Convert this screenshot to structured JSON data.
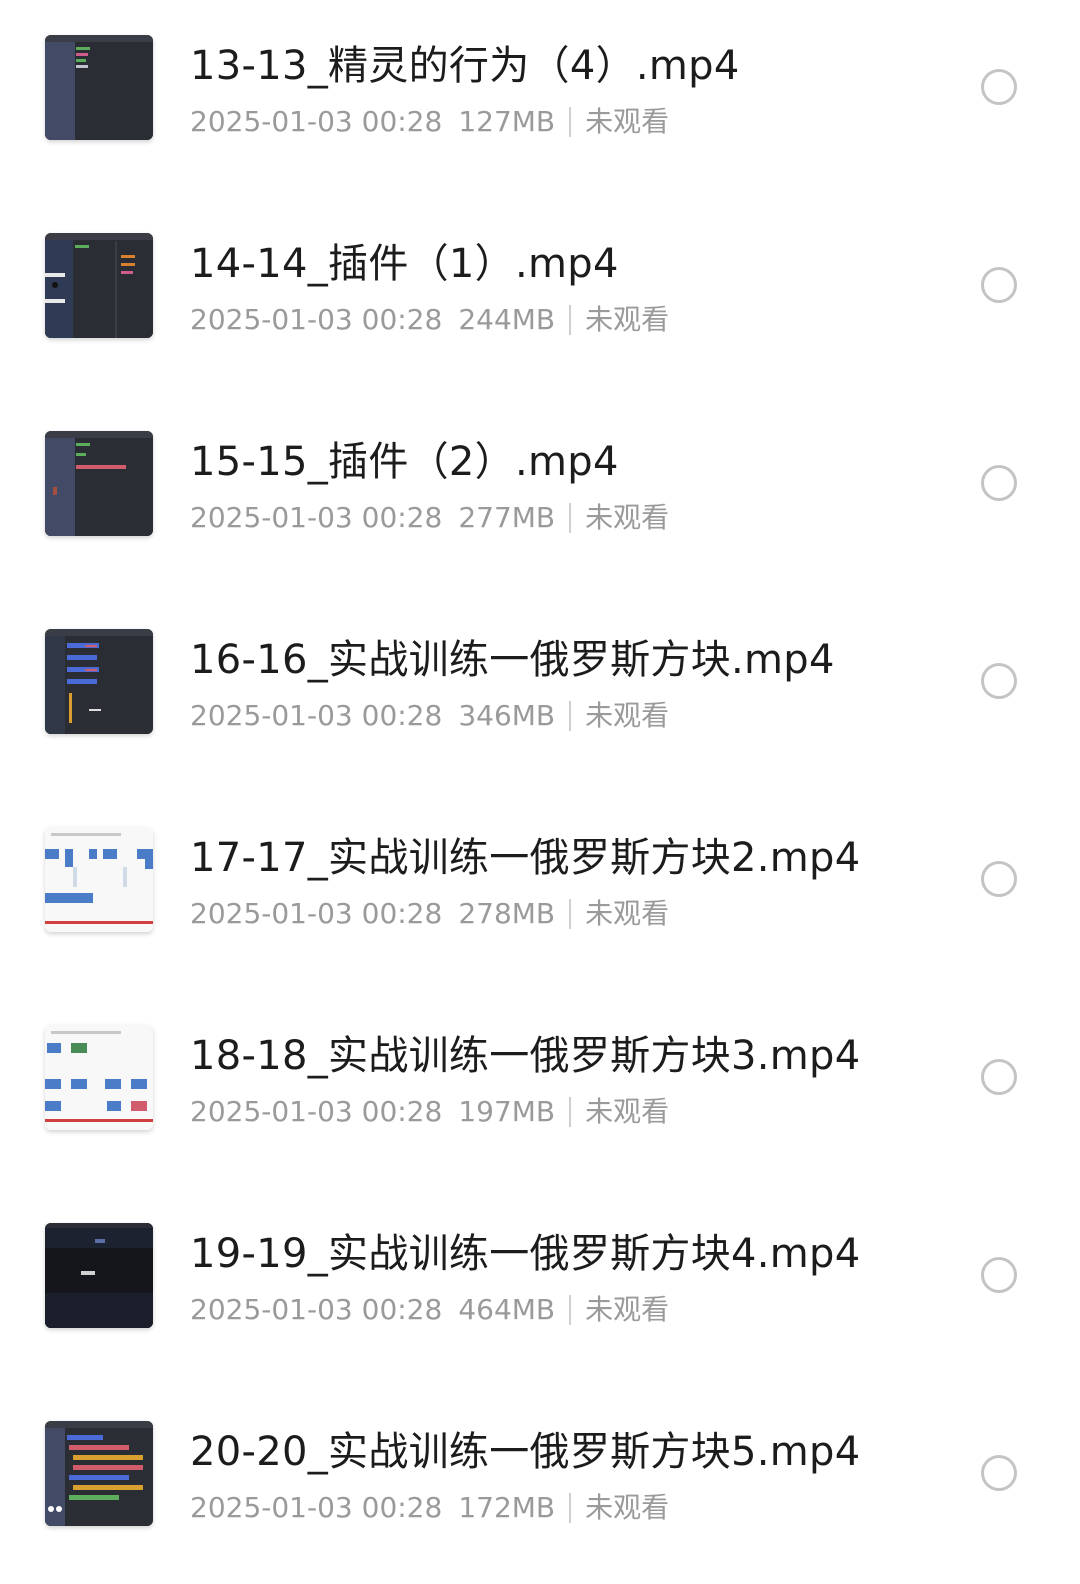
{
  "files": [
    {
      "title": "13-13_精灵的行为（4）.mp4",
      "date": "2025-01-03 00:28",
      "size": "127MB",
      "status": "未观看",
      "thumb_icon": "dark-editor-thumbnail"
    },
    {
      "title": "14-14_插件（1）.mp4",
      "date": "2025-01-03 00:28",
      "size": "244MB",
      "status": "未观看",
      "thumb_icon": "dark-editor-thumbnail"
    },
    {
      "title": "15-15_插件（2）.mp4",
      "date": "2025-01-03 00:28",
      "size": "277MB",
      "status": "未观看",
      "thumb_icon": "dark-editor-thumbnail"
    },
    {
      "title": "16-16_实战训练一俄罗斯方块.mp4",
      "date": "2025-01-03 00:28",
      "size": "346MB",
      "status": "未观看",
      "thumb_icon": "dark-editor-thumbnail"
    },
    {
      "title": "17-17_实战训练一俄罗斯方块2.mp4",
      "date": "2025-01-03 00:28",
      "size": "278MB",
      "status": "未观看",
      "thumb_icon": "white-slide-thumbnail"
    },
    {
      "title": "18-18_实战训练一俄罗斯方块3.mp4",
      "date": "2025-01-03 00:28",
      "size": "197MB",
      "status": "未观看",
      "thumb_icon": "white-slide-thumbnail"
    },
    {
      "title": "19-19_实战训练一俄罗斯方块4.mp4",
      "date": "2025-01-03 00:28",
      "size": "464MB",
      "status": "未观看",
      "thumb_icon": "dark-game-thumbnail"
    },
    {
      "title": "20-20_实战训练一俄罗斯方块5.mp4",
      "date": "2025-01-03 00:28",
      "size": "172MB",
      "status": "未观看",
      "thumb_icon": "dark-editor-thumbnail"
    }
  ],
  "colors": {
    "title": "#1c1c1c",
    "meta": "#9a9a9a",
    "radio_border": "#c4c4c4",
    "thumb_dark": "#2b2e36"
  }
}
